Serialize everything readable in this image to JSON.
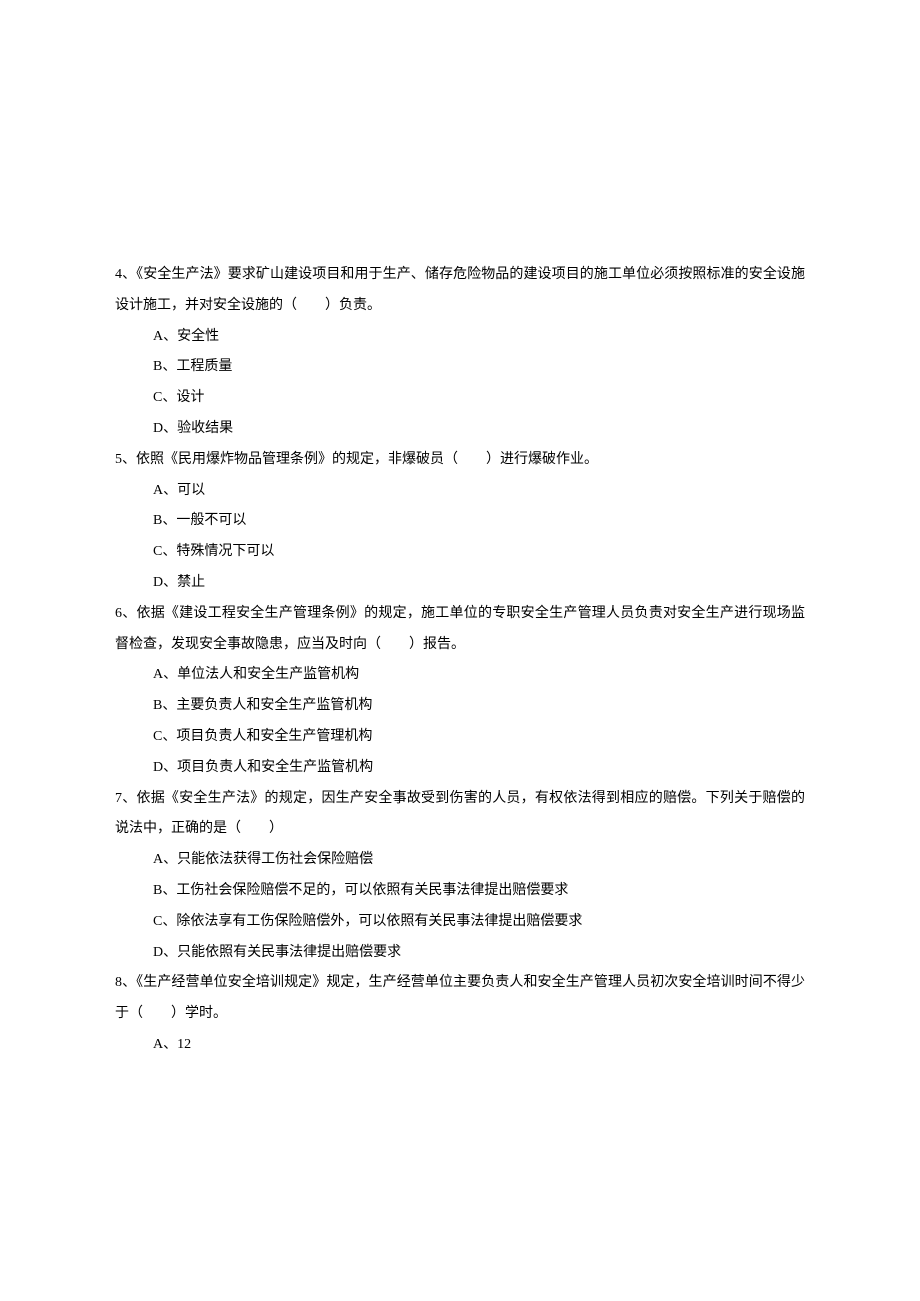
{
  "questions": [
    {
      "number": "4、",
      "stem_pre": "《安全生产法》要求矿山建设项目和用于生产、储存危险物品的建设项目的施工单位必须按照标准的安全设施设计施工，并对安全设施的（",
      "stem_post": "）负责。",
      "options": {
        "a": "A、安全性",
        "b": "B、工程质量",
        "c": "C、设计",
        "d": "D、验收结果"
      }
    },
    {
      "number": "5、",
      "stem_pre": "依照《民用爆炸物品管理条例》的规定，非爆破员（",
      "stem_post": "）进行爆破作业。",
      "options": {
        "a": "A、可以",
        "b": "B、一般不可以",
        "c": "C、特殊情况下可以",
        "d": "D、禁止"
      }
    },
    {
      "number": "6、",
      "stem_pre": "依据《建设工程安全生产管理条例》的规定，施工单位的专职安全生产管理人员负责对安全生产进行现场监督检查，发现安全事故隐患，应当及时向（",
      "stem_post": "）报告。",
      "options": {
        "a": "A、单位法人和安全生产监管机构",
        "b": "B、主要负责人和安全生产监管机构",
        "c": "C、项目负责人和安全生产管理机构",
        "d": "D、项目负责人和安全生产监管机构"
      }
    },
    {
      "number": "7、",
      "stem_pre": "依据《安全生产法》的规定，因生产安全事故受到伤害的人员，有权依法得到相应的赔偿。下列关于赔偿的说法中，正确的是（",
      "stem_post": "）",
      "options": {
        "a": "A、只能依法获得工伤社会保险赔偿",
        "b": "B、工伤社会保险赔偿不足的，可以依照有关民事法律提出赔偿要求",
        "c": "C、除依法享有工伤保险赔偿外，可以依照有关民事法律提出赔偿要求",
        "d": "D、只能依照有关民事法律提出赔偿要求"
      }
    },
    {
      "number": "8、",
      "stem_pre": "《生产经营单位安全培训规定》规定，生产经营单位主要负责人和安全生产管理人员初次安全培训时间不得少于（",
      "stem_post": "）学时。",
      "options": {
        "a": "A、12"
      }
    }
  ],
  "blank": "　　"
}
